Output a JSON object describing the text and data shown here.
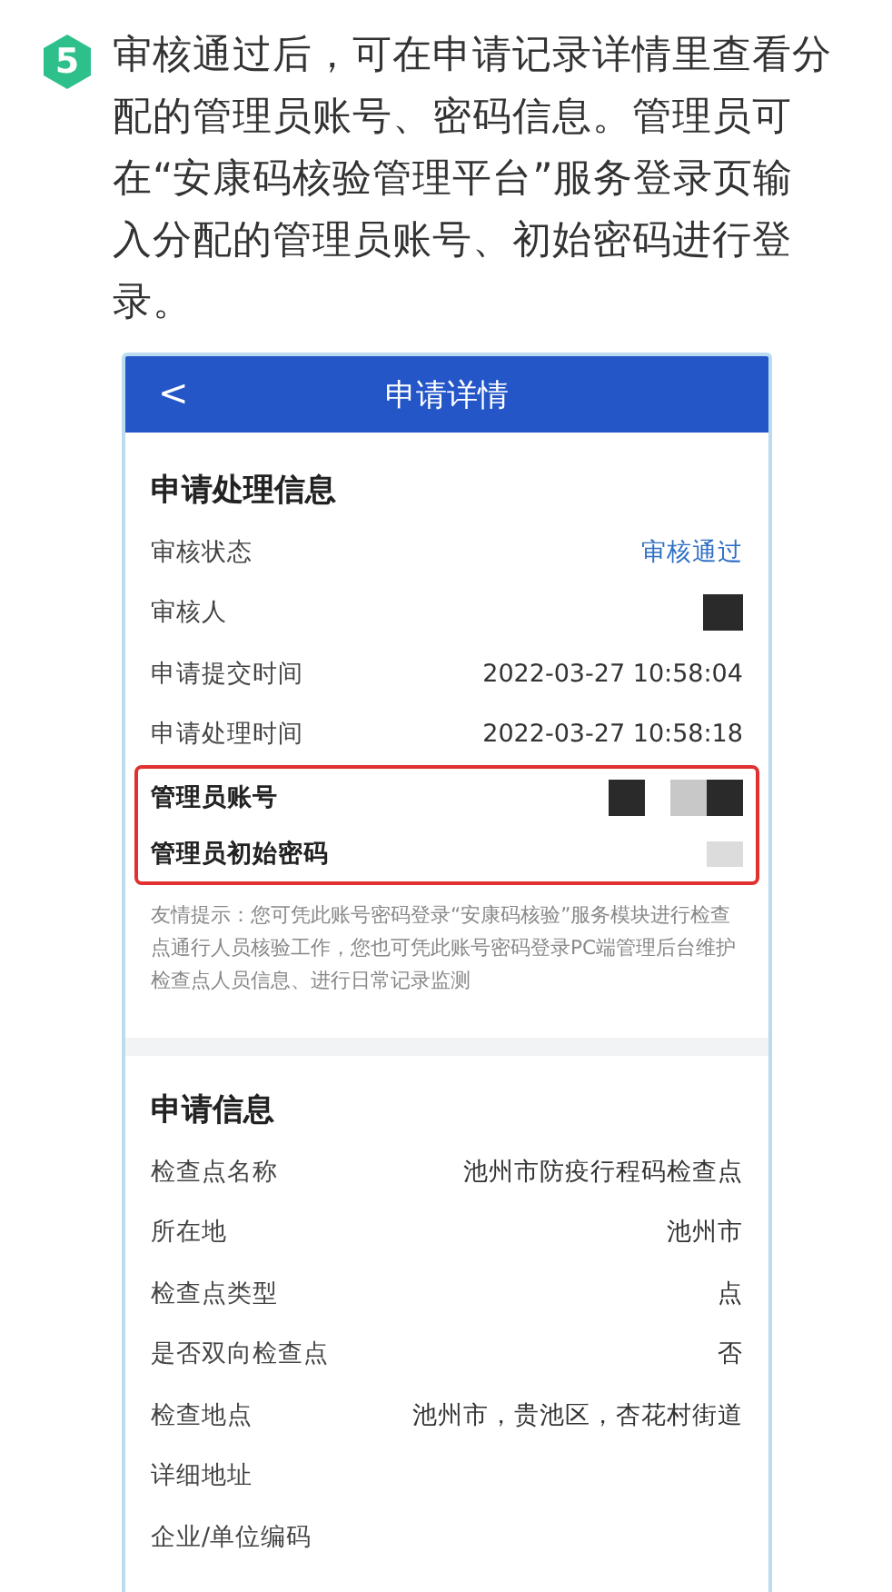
{
  "step": {
    "number": "5",
    "text": "审核通过后，可在申请记录详情里查看分配的管理员账号、密码信息。管理员可在“安康码核验管理平台”服务登录页输入分配的管理员账号、初始密码进行登录。"
  },
  "phone": {
    "back": "<",
    "title": "申请详情",
    "process_section": {
      "title": "申请处理信息",
      "rows": [
        {
          "label": "审核状态",
          "value": "审核通过",
          "kind": "status"
        },
        {
          "label": "审核人",
          "kind": "redacted"
        },
        {
          "label": "申请提交时间",
          "value": "2022-03-27 10:58:04",
          "kind": "plain"
        },
        {
          "label": "申请处理时间",
          "value": "2022-03-27 10:58:18",
          "kind": "plain"
        }
      ],
      "highlighted_rows": [
        {
          "label": "管理员账号",
          "kind": "redacted"
        },
        {
          "label": "管理员初始密码",
          "kind": "redacted"
        }
      ],
      "hint": "友情提示：您可凭此账号密码登录“安康码核验”服务模块进行检查点通行人员核验工作，您也可凭此账号密码登录PC端管理后台维护检查点人员信息、进行日常记录监测"
    },
    "application_section": {
      "title": "申请信息",
      "rows": [
        {
          "label": "检查点名称",
          "value": "池州市防疫行程码检查点",
          "kind": "plain"
        },
        {
          "label": "所在地",
          "value": "池州市",
          "kind": "plain"
        },
        {
          "label": "检查点类型",
          "value": "点",
          "kind": "plain"
        },
        {
          "label": "是否双向检查点",
          "value": "否",
          "kind": "plain"
        },
        {
          "label": "检查地点",
          "value": "池州市，贵池区，杏花村街道",
          "kind": "plain"
        },
        {
          "label": "详细地址",
          "kind": "plain"
        },
        {
          "label": "企业/单位编码",
          "kind": "plain"
        }
      ]
    }
  }
}
